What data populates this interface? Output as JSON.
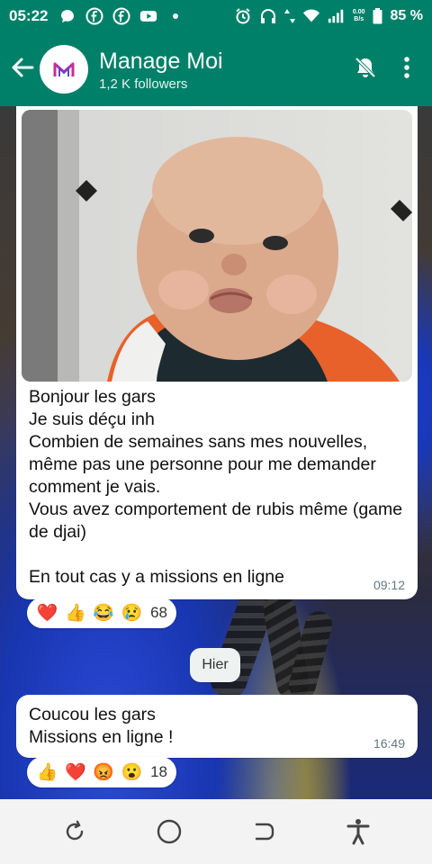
{
  "status_bar": {
    "time": "05:22",
    "net_speed_value": "0.00",
    "net_speed_unit": "B/s",
    "battery": "85 %",
    "icons": [
      "chat-bubble-icon",
      "facebook-icon",
      "facebook-icon",
      "youtube-icon",
      "dot-icon",
      "alarm-icon",
      "headphones-icon",
      "data-arrows-icon",
      "wifi-icon",
      "signal-icon",
      "battery-icon"
    ]
  },
  "header": {
    "channel_name": "Manage Moi",
    "followers": "1,2 K followers",
    "icons": [
      "back-arrow-icon",
      "bell-muted-icon",
      "more-vert-icon"
    ]
  },
  "messages": [
    {
      "text": "Bonjour les gars\nJe suis déçu inh\nCombien de semaines sans mes nouvelles, même pas une personne pour me demander comment je vais.\nVous avez comportement de rubis même (game de djai)\n\nEn tout cas y a missions en ligne",
      "time": "09:12",
      "reactions": [
        "❤️",
        "👍",
        "😂",
        "😢"
      ],
      "reaction_count": "68"
    },
    {
      "text": "Coucou les gars\nMissions en ligne !",
      "time": "16:49",
      "reactions": [
        "👍",
        "❤️",
        "😡",
        "😮"
      ],
      "reaction_count": "18"
    }
  ],
  "date_separator": "Hier",
  "colors": {
    "header_bg": "#008069",
    "bubble_bg": "#ffffff",
    "time_text": "#667781",
    "nav_bg": "#f3f3f3"
  },
  "nav_bar": {
    "icons": [
      "rotate-icon",
      "home-circle-icon",
      "recents-icon",
      "accessibility-icon"
    ]
  }
}
